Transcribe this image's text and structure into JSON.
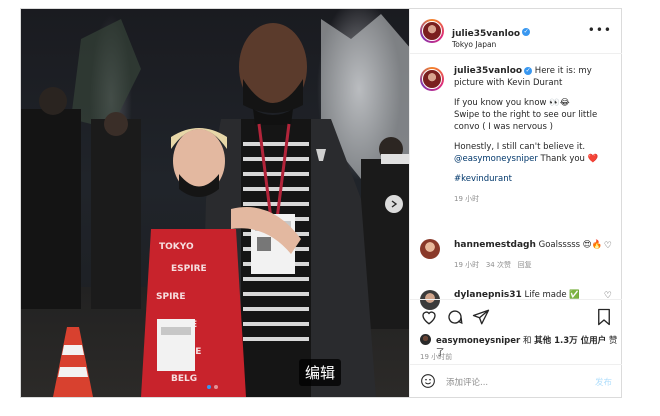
{
  "header": {
    "username": "julie35vanloo",
    "location": "Tokyo Japan",
    "more_icon": "more-icon"
  },
  "caption": {
    "username": "julie35vanloo",
    "line1": "Here it is: my picture with Kevin Durant",
    "line2": "If you know you know 👀😂",
    "line3": "Swipe to the right to see our little convo ( I was nervous )",
    "line4": "Honestly, I still can't believe it.",
    "mention": "@easymoneysniper",
    "line5_suffix": "Thank you ❤️",
    "hashtag": "#kevindurant",
    "time": "19 小时"
  },
  "comments": [
    {
      "username": "hannemestdagh",
      "text": "Goalsssss 😍🔥",
      "time": "19 小时",
      "likes": "34 次赞",
      "reply": "回复"
    },
    {
      "username": "dylanepnis31",
      "text": "Life made ✅"
    }
  ],
  "likes": {
    "user": "easymoneysniper",
    "and": "和",
    "others": "其他 1.3万 位用户",
    "liked": "赞了"
  },
  "post_time": "19 小时前",
  "add_comment": {
    "placeholder": "添加评论...",
    "post_label": "发布"
  },
  "photo": {
    "watermark": "编辑"
  },
  "colors": {
    "accent": "#3897f0",
    "link": "#00376b",
    "muted": "#8e8e8e"
  }
}
